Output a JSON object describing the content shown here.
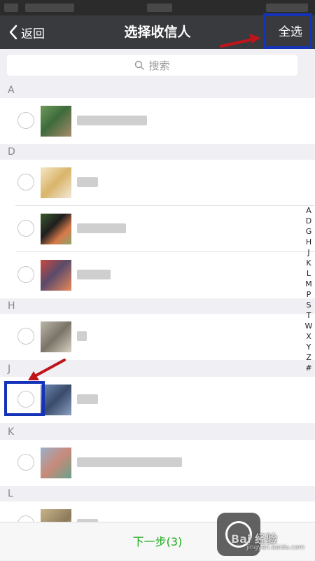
{
  "nav": {
    "back_label": "返回",
    "title": "选择收信人",
    "select_all_label": "全选"
  },
  "search": {
    "placeholder": "搜索"
  },
  "sections": [
    "A",
    "D",
    "H",
    "J",
    "K",
    "L"
  ],
  "index_letters": [
    "A",
    "D",
    "G",
    "H",
    "J",
    "K",
    "L",
    "M",
    "P",
    "S",
    "T",
    "W",
    "X",
    "Y",
    "Z",
    "#"
  ],
  "bottom": {
    "next_label": "下一步(3)"
  },
  "watermark": {
    "text": "Bai 经验",
    "sub": "jingyan.baidu.com"
  },
  "colors": {
    "nav_bg": "#393a3e",
    "highlight": "#1533b8",
    "arrow": "#c0141b",
    "next_text": "#1aad19"
  }
}
